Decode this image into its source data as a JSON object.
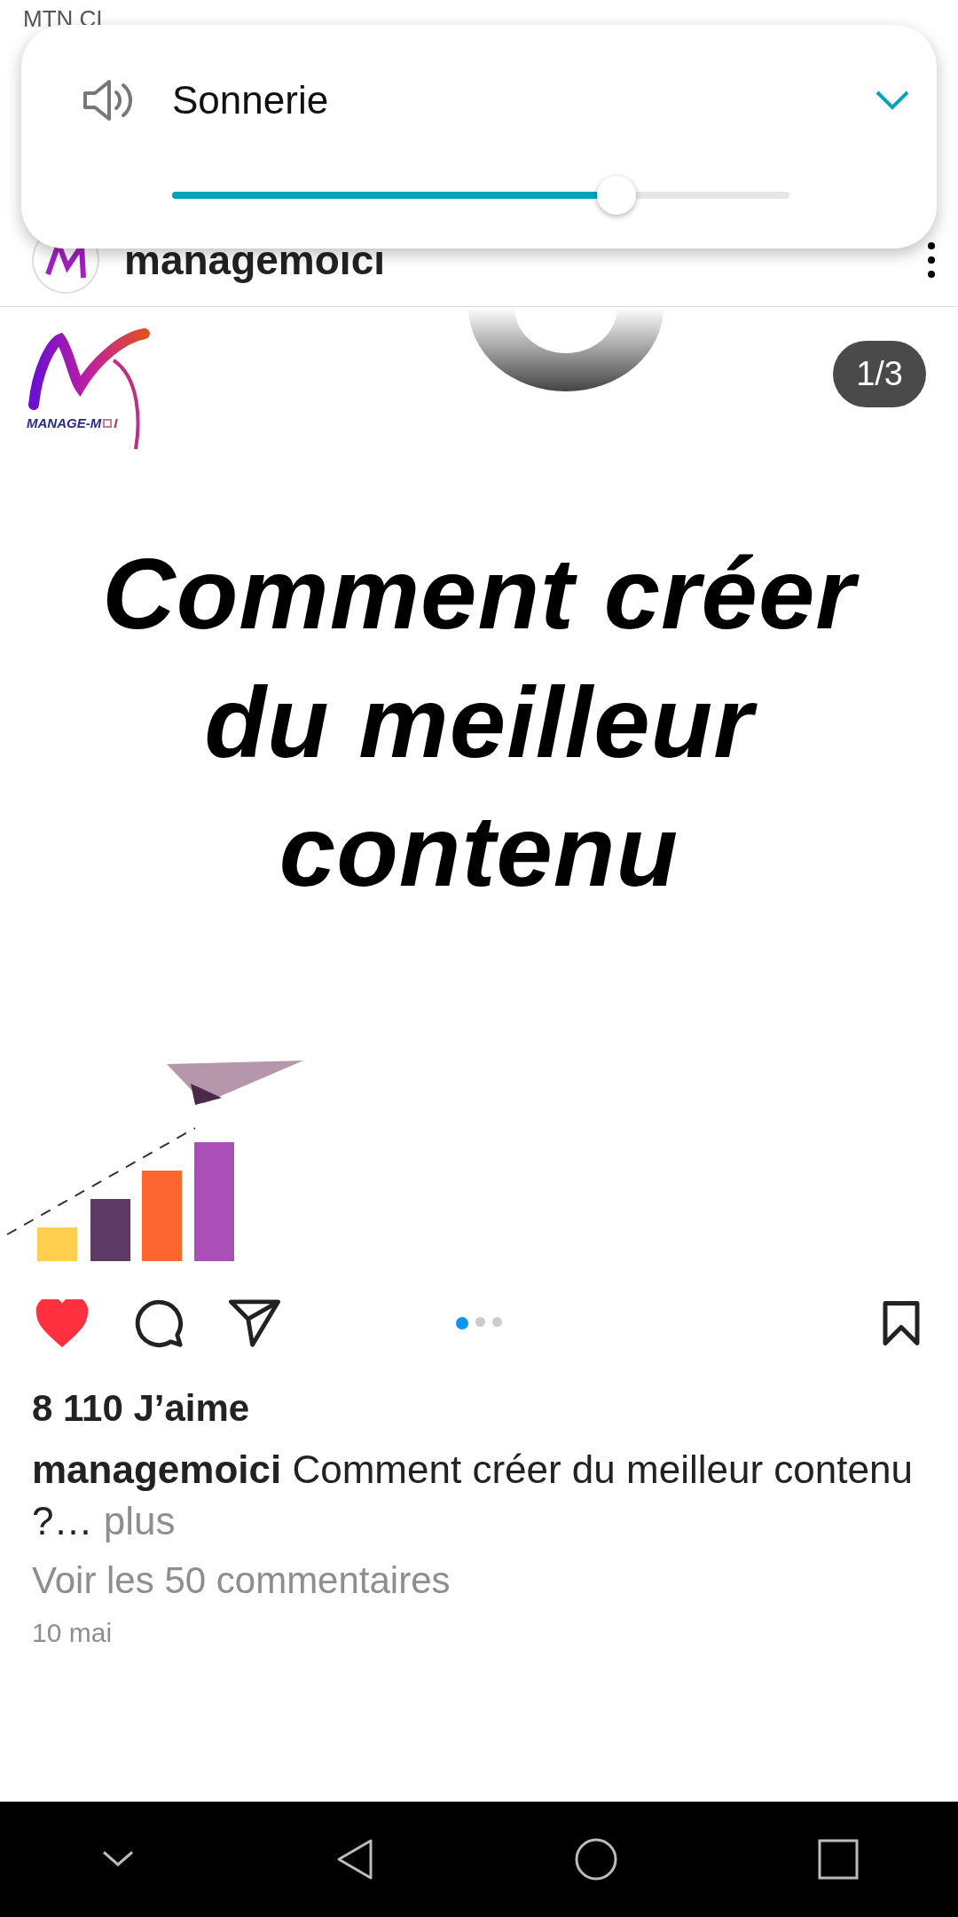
{
  "status_bar": {
    "carrier": "MTN CI"
  },
  "volume_panel": {
    "label": "Sonnerie",
    "level": 0.72,
    "expanded": false
  },
  "post": {
    "username": "managemoici",
    "logo_text": [
      "MANAGE-M",
      "I"
    ],
    "counter": "1/3",
    "title_lines": [
      "Comment créer",
      "du meilleur",
      "contenu"
    ],
    "slides": [
      {
        "selected": true
      },
      {
        "selected": false
      },
      {
        "selected": false
      }
    ],
    "liked": true,
    "likes": "8 110 J’aime",
    "caption": "**managemoici** Comment créer du meilleur contenu ?…",
    "more": "plus",
    "comments_link": "Voir les 50 commentaires",
    "date": "10 mai"
  }
}
